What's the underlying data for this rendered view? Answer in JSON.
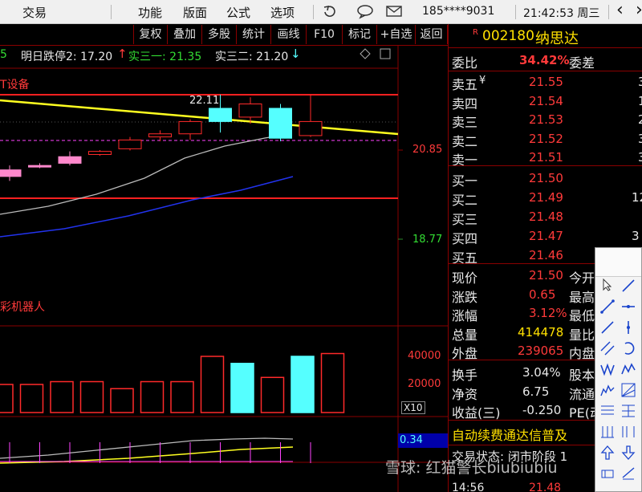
{
  "menubar": {
    "app_title": "交易",
    "items": [
      "功能",
      "版面",
      "公式",
      "选项"
    ],
    "account": "185****9031",
    "clock": "21:42:53 周三",
    "back_arrow": "‹",
    "forward_arrow": "›"
  },
  "toolbar": {
    "buttons": [
      "复权",
      "叠加",
      "多股",
      "统计",
      "画线",
      "F10",
      "标记",
      "+自选",
      "返回"
    ]
  },
  "chart": {
    "info_prefix": "5",
    "limit_down": "明日跌停2: 17.20",
    "limit_down_arrow": "↑",
    "ma1": "实三一: 21.35",
    "ma2": "实三二: 21.20",
    "ma2_arrow": "↓",
    "sector_label": "T设备",
    "annotation_value": "22.11",
    "price_axis": [
      "20.85",
      "18.77"
    ],
    "vol_label": "彩机器人",
    "vol_axis": [
      "40000",
      "20000"
    ],
    "vol_multiplier": "X10",
    "indicator_axis": "0.34"
  },
  "chart_data": {
    "type": "candlestick",
    "candles": [
      {
        "open": 20.4,
        "high": 20.5,
        "low": 20.15,
        "close": 20.25,
        "color": "pink"
      },
      {
        "open": 20.48,
        "high": 20.55,
        "low": 20.44,
        "close": 20.5,
        "color": "pink"
      },
      {
        "open": 20.55,
        "high": 20.82,
        "low": 20.5,
        "close": 20.7,
        "color": "pink"
      },
      {
        "open": 20.75,
        "high": 20.85,
        "low": 20.72,
        "close": 20.82,
        "color": "red"
      },
      {
        "open": 20.88,
        "high": 21.15,
        "low": 20.84,
        "close": 21.08,
        "color": "red"
      },
      {
        "open": 21.15,
        "high": 21.3,
        "low": 21.05,
        "close": 21.22,
        "color": "red"
      },
      {
        "open": 21.22,
        "high": 21.55,
        "low": 21.08,
        "close": 21.5,
        "color": "red"
      },
      {
        "open": 21.8,
        "high": 22.11,
        "low": 21.25,
        "close": 21.5,
        "color": "cyan"
      },
      {
        "open": 21.6,
        "high": 22.05,
        "low": 21.45,
        "close": 21.9,
        "color": "red"
      },
      {
        "open": 21.8,
        "high": 21.9,
        "low": 21.05,
        "close": 21.12,
        "color": "cyan"
      },
      {
        "open": 21.18,
        "high": 22.1,
        "low": 21.15,
        "close": 21.5,
        "color": "red"
      }
    ],
    "volume": [
      20000,
      20000,
      22000,
      22000,
      17000,
      22000,
      22000,
      40000,
      35000,
      25000,
      40000,
      42000
    ],
    "volume_colors": [
      "red",
      "red",
      "red",
      "red",
      "red",
      "red",
      "red",
      "red",
      "cyan",
      "red",
      "cyan",
      "red"
    ],
    "price_ticks": [
      20.85,
      18.77
    ],
    "volume_ticks": [
      40000,
      20000
    ]
  },
  "quote": {
    "code": "002180",
    "name": "纳思达",
    "code_marker": "R",
    "weibi_label": "委比",
    "weibi_value": "34.42%",
    "weicha_label": "委差",
    "sell": [
      {
        "label": "卖五",
        "value": "21.55",
        "qty": "3",
        "flag": "¥"
      },
      {
        "label": "卖四",
        "value": "21.54",
        "qty": "1",
        "flag": ""
      },
      {
        "label": "卖三",
        "value": "21.53",
        "qty": "2",
        "flag": ""
      },
      {
        "label": "卖二",
        "value": "21.52",
        "qty": "3",
        "flag": ""
      },
      {
        "label": "卖一",
        "value": "21.51",
        "qty": "3",
        "flag": ""
      }
    ],
    "buy": [
      {
        "label": "买一",
        "value": "21.50",
        "qty": ""
      },
      {
        "label": "买二",
        "value": "21.49",
        "qty": "12"
      },
      {
        "label": "买三",
        "value": "21.48",
        "qty": ""
      },
      {
        "label": "买四",
        "value": "21.47",
        "qty": "3"
      },
      {
        "label": "买五",
        "value": "21.46",
        "qty": ""
      }
    ],
    "stats": [
      {
        "label": "现价",
        "value": "21.50",
        "r": "今开",
        "color": "red"
      },
      {
        "label": "涨跌",
        "value": "0.65",
        "r": "最高",
        "color": "red"
      },
      {
        "label": "涨幅",
        "value": "3.12%",
        "r": "最低",
        "color": "red"
      },
      {
        "label": "总量",
        "value": "414478",
        "r": "量比",
        "color": "yel"
      },
      {
        "label": "外盘",
        "value": "239065",
        "r": "内盘",
        "color": "red"
      }
    ],
    "stats2": [
      {
        "label": "换手",
        "value": "3.04%",
        "r": "股本"
      },
      {
        "label": "净资",
        "value": "6.75",
        "r": "流通"
      },
      {
        "label": "收益(三)",
        "value": "-0.250",
        "r": "PE(动"
      }
    ],
    "ticker": "自动续费通达信普及",
    "trade_status": "交易状态: 闭市阶段 1",
    "tick_time": "14:56",
    "tick_price": "21.48"
  },
  "watermark": "雪球: 红猫警长biubiubiu"
}
